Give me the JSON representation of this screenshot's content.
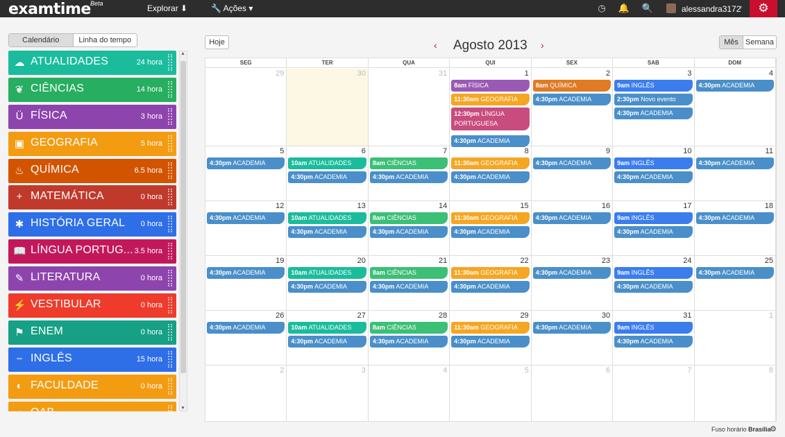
{
  "topbar": {
    "logo": "examtime",
    "logo_badge": "Beta",
    "explore_label": "Explorar",
    "actions_label": "Ações",
    "user_name": "alessandra3172"
  },
  "sidebar": {
    "view_toggle": [
      "Calendário",
      "Linha do tempo"
    ],
    "categories": [
      {
        "name": "ATUALIDADES",
        "hours": "24 hora",
        "color": "#1abc9c",
        "icon": "brain-icon"
      },
      {
        "name": "CIÊNCIAS",
        "hours": "14 hora",
        "color": "#27ae60",
        "icon": "leaf-icon"
      },
      {
        "name": "FÍSICA",
        "hours": "3 hora",
        "color": "#8e44ad",
        "icon": "magnet-icon"
      },
      {
        "name": "GEOGRAFIA",
        "hours": "5 hora",
        "color": "#f39c12",
        "icon": "picture-icon"
      },
      {
        "name": "QUÍMICA",
        "hours": "6.5 hora",
        "color": "#d35400",
        "icon": "flame-icon"
      },
      {
        "name": "MATEMÁTICA",
        "hours": "0 hora",
        "color": "#c0392b",
        "icon": "plus-icon"
      },
      {
        "name": "HISTÓRIA GERAL",
        "hours": "0 hora",
        "color": "#2e6fe8",
        "icon": "asterisk-icon"
      },
      {
        "name": "LÍNGUA PORTUG...",
        "hours": "3.5 hora",
        "color": "#c2185b",
        "icon": "book-icon"
      },
      {
        "name": "LITERATURA",
        "hours": "0 hora",
        "color": "#8e44ad",
        "icon": "pencil-icon"
      },
      {
        "name": "VESTIBULAR",
        "hours": "0 hora",
        "color": "#ee3b2b",
        "icon": "wand-icon"
      },
      {
        "name": "ENEM",
        "hours": "0 hora",
        "color": "#16a085",
        "icon": "flag-icon"
      },
      {
        "name": "INGLÊS",
        "hours": "15 hora",
        "color": "#2e6fe8",
        "icon": "minus-icon"
      },
      {
        "name": "FACULDADE",
        "hours": "0 hora",
        "color": "#f39c12",
        "icon": "contrast-icon"
      },
      {
        "name": "OAB",
        "hours": "",
        "color": "#f39c12",
        "icon": "circle-icon"
      }
    ]
  },
  "calendar": {
    "today_label": "Hoje",
    "title": "Agosto 2013",
    "view_month": "Mês",
    "view_week": "Semana",
    "weekdays": [
      "SEG",
      "TER",
      "QUA",
      "QUI",
      "SEX",
      "SAB",
      "DOM"
    ],
    "colors": {
      "academia": "#4a8fc9",
      "atualidades": "#1abc9c",
      "ciencias": "#2ecc71",
      "geografia": "#f5a623",
      "fisica": "#9b59b6",
      "quimica": "#e67e22",
      "ingles": "#3b7ded",
      "lingua": "#c2185b"
    },
    "weeks": [
      [
        {
          "num": "29",
          "other": true,
          "events": []
        },
        {
          "num": "30",
          "other": true,
          "today": true,
          "events": []
        },
        {
          "num": "31",
          "other": true,
          "events": []
        },
        {
          "num": "1",
          "events": [
            {
              "time": "8am",
              "title": "FÍSICA",
              "color": "#9b59b6"
            },
            {
              "time": "11:30am",
              "title": "GEOGRAFIA",
              "color": "#f5a623"
            },
            {
              "time": "12:30pm",
              "title": "LÍNGUA PORTUGUESA",
              "color": "#c94c7e",
              "tall": true
            },
            {
              "time": "4:30pm",
              "title": "ACADEMIA",
              "color": "#4a8fc9"
            }
          ]
        },
        {
          "num": "2",
          "events": [
            {
              "time": "8am",
              "title": "QUÍMICA",
              "color": "#e07b24"
            },
            {
              "time": "4:30pm",
              "title": "ACADEMIA",
              "color": "#4a8fc9"
            }
          ]
        },
        {
          "num": "3",
          "events": [
            {
              "time": "9am",
              "title": "INGLÊS",
              "color": "#3b7ded"
            },
            {
              "time": "2:30pm",
              "title": "Novo evento",
              "color": "#4a8fc9"
            },
            {
              "time": "4:30pm",
              "title": "ACADEMIA",
              "color": "#4a8fc9"
            }
          ]
        },
        {
          "num": "4",
          "events": [
            {
              "time": "4:30pm",
              "title": "ACADEMIA",
              "color": "#4a8fc9"
            }
          ]
        }
      ],
      [
        {
          "num": "5",
          "events": [
            {
              "time": "4:30pm",
              "title": "ACADEMIA",
              "color": "#4a8fc9"
            }
          ]
        },
        {
          "num": "6",
          "events": [
            {
              "time": "10am",
              "title": "ATUALIDADES",
              "color": "#1abc9c"
            },
            {
              "time": "4:30pm",
              "title": "ACADEMIA",
              "color": "#4a8fc9"
            }
          ]
        },
        {
          "num": "7",
          "events": [
            {
              "time": "8am",
              "title": "CIÊNCIAS",
              "color": "#3cbf76"
            },
            {
              "time": "4:30pm",
              "title": "ACADEMIA",
              "color": "#4a8fc9"
            }
          ]
        },
        {
          "num": "8",
          "events": [
            {
              "time": "11:30am",
              "title": "GEOGRAFIA",
              "color": "#f5a623"
            },
            {
              "time": "4:30pm",
              "title": "ACADEMIA",
              "color": "#4a8fc9"
            }
          ]
        },
        {
          "num": "9",
          "events": [
            {
              "time": "4:30pm",
              "title": "ACADEMIA",
              "color": "#4a8fc9"
            }
          ]
        },
        {
          "num": "10",
          "events": [
            {
              "time": "9am",
              "title": "INGLÊS",
              "color": "#3b7ded"
            },
            {
              "time": "4:30pm",
              "title": "ACADEMIA",
              "color": "#4a8fc9"
            }
          ]
        },
        {
          "num": "11",
          "events": [
            {
              "time": "4:30pm",
              "title": "ACADEMIA",
              "color": "#4a8fc9"
            }
          ]
        }
      ],
      [
        {
          "num": "12",
          "events": [
            {
              "time": "4:30pm",
              "title": "ACADEMIA",
              "color": "#4a8fc9"
            }
          ]
        },
        {
          "num": "13",
          "events": [
            {
              "time": "10am",
              "title": "ATUALIDADES",
              "color": "#1abc9c"
            },
            {
              "time": "4:30pm",
              "title": "ACADEMIA",
              "color": "#4a8fc9"
            }
          ]
        },
        {
          "num": "14",
          "events": [
            {
              "time": "8am",
              "title": "CIÊNCIAS",
              "color": "#3cbf76"
            },
            {
              "time": "4:30pm",
              "title": "ACADEMIA",
              "color": "#4a8fc9"
            }
          ]
        },
        {
          "num": "15",
          "events": [
            {
              "time": "11:30am",
              "title": "GEOGRAFIA",
              "color": "#f5a623"
            },
            {
              "time": "4:30pm",
              "title": "ACADEMIA",
              "color": "#4a8fc9"
            }
          ]
        },
        {
          "num": "16",
          "events": [
            {
              "time": "4:30pm",
              "title": "ACADEMIA",
              "color": "#4a8fc9"
            }
          ]
        },
        {
          "num": "17",
          "events": [
            {
              "time": "9am",
              "title": "INGLÊS",
              "color": "#3b7ded"
            },
            {
              "time": "4:30pm",
              "title": "ACADEMIA",
              "color": "#4a8fc9"
            }
          ]
        },
        {
          "num": "18",
          "events": [
            {
              "time": "4:30pm",
              "title": "ACADEMIA",
              "color": "#4a8fc9"
            }
          ]
        }
      ],
      [
        {
          "num": "19",
          "events": [
            {
              "time": "4:30pm",
              "title": "ACADEMIA",
              "color": "#4a8fc9"
            }
          ]
        },
        {
          "num": "20",
          "events": [
            {
              "time": "10am",
              "title": "ATUALIDADES",
              "color": "#1abc9c"
            },
            {
              "time": "4:30pm",
              "title": "ACADEMIA",
              "color": "#4a8fc9"
            }
          ]
        },
        {
          "num": "21",
          "events": [
            {
              "time": "8am",
              "title": "CIÊNCIAS",
              "color": "#3cbf76"
            },
            {
              "time": "4:30pm",
              "title": "ACADEMIA",
              "color": "#4a8fc9"
            }
          ]
        },
        {
          "num": "22",
          "events": [
            {
              "time": "11:30am",
              "title": "GEOGRAFIA",
              "color": "#f5a623"
            },
            {
              "time": "4:30pm",
              "title": "ACADEMIA",
              "color": "#4a8fc9"
            }
          ]
        },
        {
          "num": "23",
          "events": [
            {
              "time": "4:30pm",
              "title": "ACADEMIA",
              "color": "#4a8fc9"
            }
          ]
        },
        {
          "num": "24",
          "events": [
            {
              "time": "9am",
              "title": "INGLÊS",
              "color": "#3b7ded"
            },
            {
              "time": "4:30pm",
              "title": "ACADEMIA",
              "color": "#4a8fc9"
            }
          ]
        },
        {
          "num": "25",
          "events": [
            {
              "time": "4:30pm",
              "title": "ACADEMIA",
              "color": "#4a8fc9"
            }
          ]
        }
      ],
      [
        {
          "num": "26",
          "events": [
            {
              "time": "4:30pm",
              "title": "ACADEMIA",
              "color": "#4a8fc9"
            }
          ]
        },
        {
          "num": "27",
          "events": [
            {
              "time": "10am",
              "title": "ATUALIDADES",
              "color": "#1abc9c"
            },
            {
              "time": "4:30pm",
              "title": "ACADEMIA",
              "color": "#4a8fc9"
            }
          ]
        },
        {
          "num": "28",
          "events": [
            {
              "time": "8am",
              "title": "CIÊNCIAS",
              "color": "#3cbf76"
            },
            {
              "time": "4:30pm",
              "title": "ACADEMIA",
              "color": "#4a8fc9"
            }
          ]
        },
        {
          "num": "29",
          "events": [
            {
              "time": "11:30am",
              "title": "GEOGRAFIA",
              "color": "#f5a623"
            },
            {
              "time": "4:30pm",
              "title": "ACADEMIA",
              "color": "#4a8fc9"
            }
          ]
        },
        {
          "num": "30",
          "events": [
            {
              "time": "4:30pm",
              "title": "ACADEMIA",
              "color": "#4a8fc9"
            }
          ]
        },
        {
          "num": "31",
          "events": [
            {
              "time": "9am",
              "title": "INGLÊS",
              "color": "#3b7ded"
            },
            {
              "time": "4:30pm",
              "title": "ACADEMIA",
              "color": "#4a8fc9"
            }
          ]
        },
        {
          "num": "1",
          "other": true,
          "events": []
        }
      ],
      [
        {
          "num": "2",
          "other": true,
          "events": []
        },
        {
          "num": "3",
          "other": true,
          "events": []
        },
        {
          "num": "4",
          "other": true,
          "events": []
        },
        {
          "num": "5",
          "other": true,
          "events": []
        },
        {
          "num": "6",
          "other": true,
          "events": []
        },
        {
          "num": "7",
          "other": true,
          "events": []
        },
        {
          "num": "8",
          "other": true,
          "events": []
        }
      ]
    ]
  },
  "footer": {
    "timezone_label": "Fuso horário",
    "timezone_value": "Brasília"
  }
}
